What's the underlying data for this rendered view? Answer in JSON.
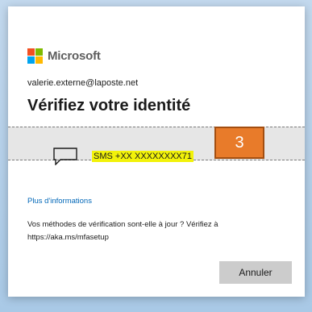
{
  "brand": {
    "name": "Microsoft",
    "colors": [
      "#f25022",
      "#7fba00",
      "#00a4ef",
      "#ffb900"
    ]
  },
  "account": {
    "email": "valerie.externe@laposte.net"
  },
  "page": {
    "title": "Vérifiez votre identité"
  },
  "method": {
    "icon": "message-bubble-icon",
    "label": "SMS +XX XXXXXXXX71",
    "highlight_color": "#f2f20a"
  },
  "annotation": {
    "step": "3",
    "color": "#e87b2a"
  },
  "links": {
    "more_info": "Plus d'informations"
  },
  "notice": {
    "text": "Vos méthodes de vérification sont-elle à jour ? Vérifiez à https://aka.ms/mfasetup"
  },
  "buttons": {
    "cancel": "Annuler"
  }
}
